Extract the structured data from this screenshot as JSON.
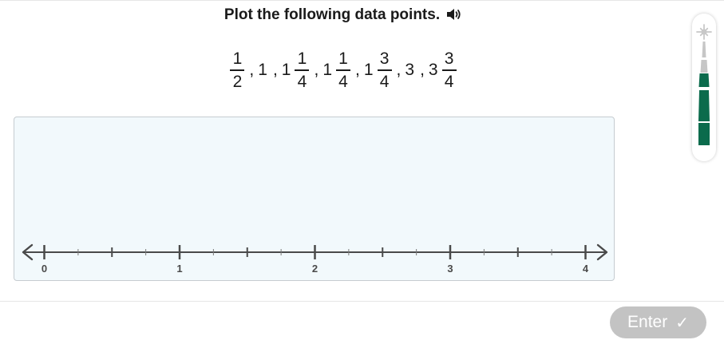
{
  "prompt": {
    "text": "Plot the following data points.",
    "audio_icon": "speaker-icon"
  },
  "data_points": [
    {
      "whole": "",
      "num": "1",
      "den": "2"
    },
    {
      "whole": "1",
      "num": "",
      "den": ""
    },
    {
      "whole": "1",
      "num": "1",
      "den": "4"
    },
    {
      "whole": "1",
      "num": "1",
      "den": "4"
    },
    {
      "whole": "1",
      "num": "3",
      "den": "4"
    },
    {
      "whole": "3",
      "num": "",
      "den": ""
    },
    {
      "whole": "3",
      "num": "3",
      "den": "4"
    }
  ],
  "separator": ",",
  "number_line": {
    "min": 0,
    "max": 4,
    "step": 0.25,
    "major_labels": [
      "0",
      "1",
      "2",
      "3",
      "4"
    ],
    "arrow_color": "#4a4a4a"
  },
  "progress": {
    "icon": "sparkle-icon",
    "segments": [
      "gray",
      "gray",
      "green",
      "green",
      "green"
    ],
    "colors": {
      "gray": "#c6c6c6",
      "green": "#0b6b4c"
    }
  },
  "enter_button": {
    "label": "Enter",
    "check": "✓",
    "color": "#c3c3c3"
  }
}
